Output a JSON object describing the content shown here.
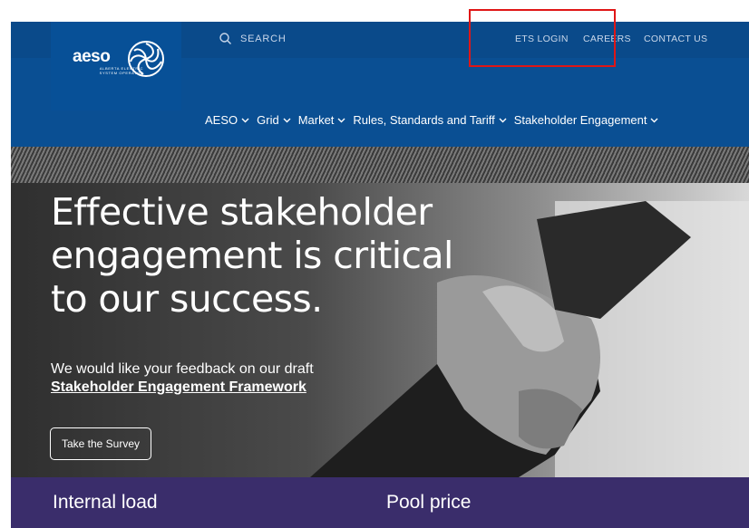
{
  "brand": {
    "logo_text": "aeso",
    "logo_subtitle": "ALBERTA ELECTRIC SYSTEM OPERATOR"
  },
  "header": {
    "search_label": "SEARCH",
    "links": [
      "ETS LOGIN",
      "CAREERS",
      "CONTACT US"
    ]
  },
  "nav": {
    "items": [
      "AESO",
      "Grid",
      "Market",
      "Rules, Standards and Tariff",
      "Stakeholder Engagement"
    ]
  },
  "hero": {
    "title_lines": [
      "Effective stakeholder",
      "engagement is critical",
      "to our success."
    ],
    "body_text": "We would like your feedback on our draft",
    "link_text": "Stakeholder Engagement Framework",
    "button_label": "Take the Survey"
  },
  "stats": {
    "left_title": "Internal load",
    "right_title": "Pool price"
  },
  "colors": {
    "header_blue": "#0a4f93",
    "stats_purple": "#3a2d6b",
    "highlight_red": "#e01616"
  }
}
